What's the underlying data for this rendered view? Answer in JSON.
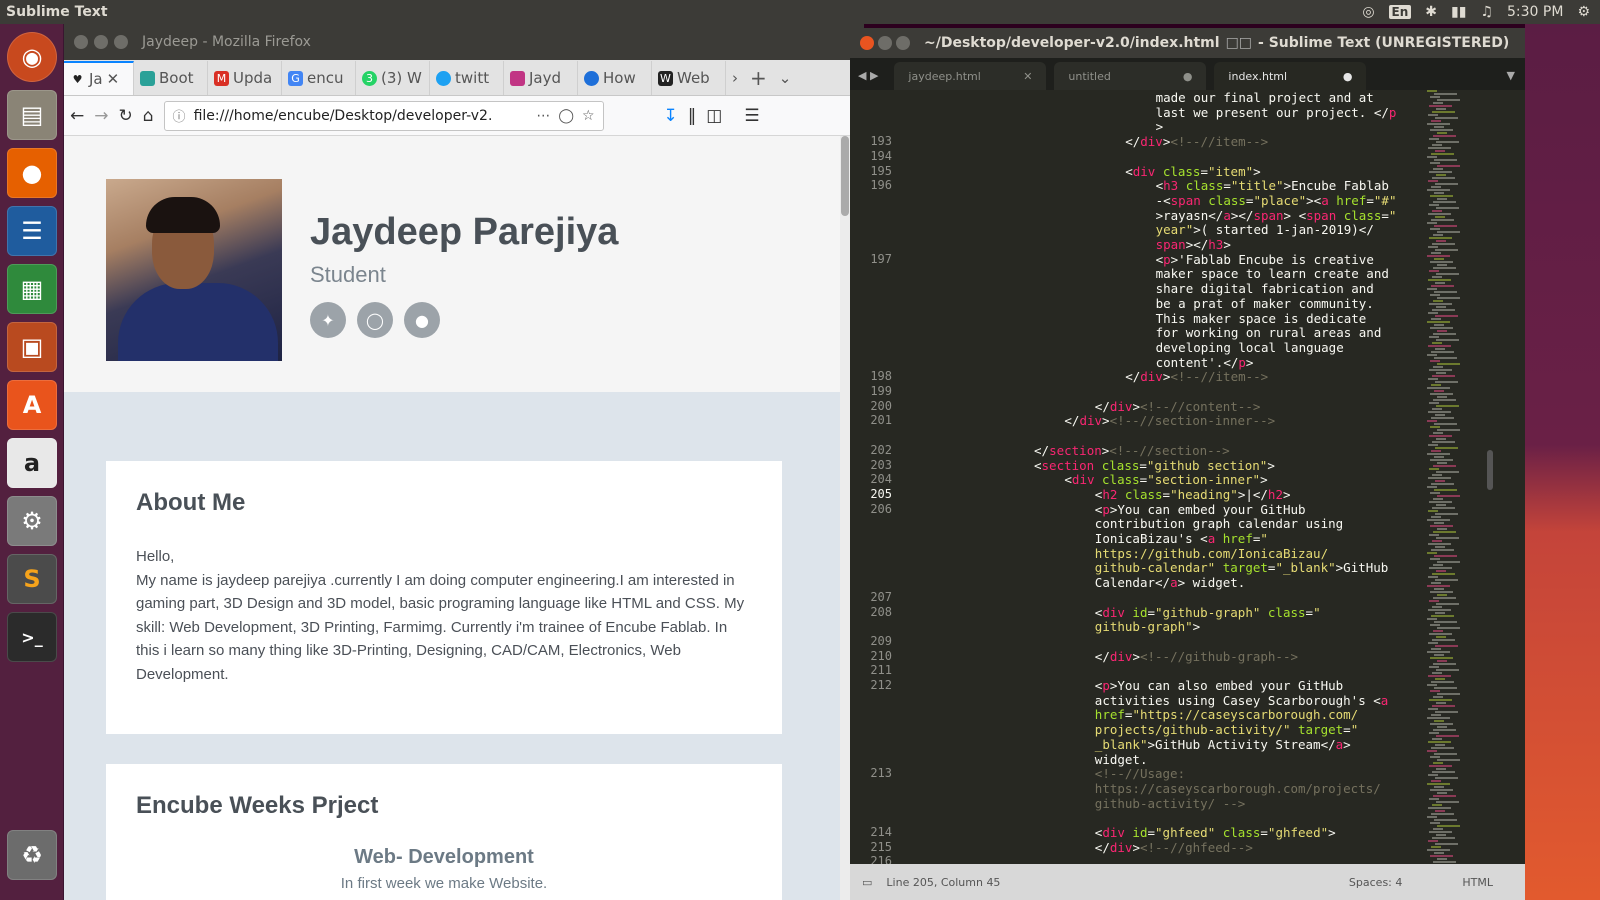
{
  "top_panel": {
    "app_name": "Sublime Text",
    "language": "En",
    "time": "5:30 PM"
  },
  "launcher": {
    "items": [
      "Ubuntu Dash",
      "Files",
      "Firefox",
      "LibreOffice Writer",
      "LibreOffice Calc",
      "LibreOffice Impress",
      "Ubuntu Software",
      "Amazon",
      "System Settings",
      "Sublime Text",
      "Terminal",
      "Trash"
    ]
  },
  "firefox": {
    "title": "Jaydeep - Mozilla Firefox",
    "tabs": [
      "Ja",
      "Boot",
      "Upda",
      "encu",
      "(3) W",
      "twitt",
      "Jayd",
      "How",
      "Web"
    ],
    "url": "file:///home/encube/Desktop/developer-v2."
  },
  "page": {
    "name": "Jaydeep Parejiya",
    "role": "Student",
    "about_title": "About Me",
    "about_text_1": "Hello,",
    "about_text_2": "My name is jaydeep parejiya .currently I am doing computer engineering.I am interested in gaming part, 3D Design and 3D model, basic programing language like HTML and CSS. My skill: Web Development, 3D Printing, Farmimg. Currently i'm trainee of Encube Fablab. In this i learn so many thing like 3D-Printing, Designing, CAD/CAM, Electronics, Web Development.",
    "weeks_title": "Encube Weeks Prject",
    "week1_title": "Web- Development",
    "week1_text": "In first week we make Website."
  },
  "sublime": {
    "title": "~/Desktop/developer-v2.0/index.html",
    "title_suffix": "- Sublime Text (UNREGISTERED)",
    "tabs": [
      "jaydeep.html",
      "untitled",
      "index.html"
    ],
    "status_position": "Line 205, Column 45",
    "status_spaces": "Spaces: 4",
    "status_syntax": "HTML"
  },
  "gutter_numbers": [
    {
      "n": "193",
      "r": 3
    },
    {
      "n": "194",
      "r": 4
    },
    {
      "n": "195",
      "r": 5
    },
    {
      "n": "196",
      "r": 6
    },
    {
      "n": "197",
      "r": 11
    },
    {
      "n": "198",
      "r": 19
    },
    {
      "n": "199",
      "r": 20
    },
    {
      "n": "200",
      "r": 21
    },
    {
      "n": "201",
      "r": 22
    },
    {
      "n": "202",
      "r": 24
    },
    {
      "n": "203",
      "r": 25
    },
    {
      "n": "204",
      "r": 26
    },
    {
      "n": "205",
      "r": 27
    },
    {
      "n": "206",
      "r": 28
    },
    {
      "n": "207",
      "r": 34
    },
    {
      "n": "208",
      "r": 35
    },
    {
      "n": "209",
      "r": 37
    },
    {
      "n": "210",
      "r": 38
    },
    {
      "n": "211",
      "r": 39
    },
    {
      "n": "212",
      "r": 40
    },
    {
      "n": "213",
      "r": 46
    },
    {
      "n": "214",
      "r": 50
    },
    {
      "n": "215",
      "r": 51
    },
    {
      "n": "216",
      "r": 52
    }
  ],
  "code_lines": [
    {
      "r": 0,
      "i": 16,
      "t": [
        [
          "",
          "made our final project and at"
        ]
      ]
    },
    {
      "r": 1,
      "i": 16,
      "t": [
        [
          "",
          "last we present our project. </"
        ],
        [
          "tg",
          "p"
        ]
      ]
    },
    {
      "r": 2,
      "i": 16,
      "t": [
        [
          "",
          ">"
        ]
      ]
    },
    {
      "r": 3,
      "i": 12,
      "t": [
        [
          "",
          "</"
        ],
        [
          "tg",
          "div"
        ],
        [
          "",
          ">"
        ],
        [
          "cm",
          "<!--//item-->"
        ]
      ]
    },
    {
      "r": 5,
      "i": 12,
      "t": [
        [
          "",
          "<"
        ],
        [
          "tg",
          "div"
        ],
        [
          "at",
          " class"
        ],
        [
          "",
          "="
        ],
        [
          "st",
          "\"item\""
        ],
        [
          "",
          ">"
        ]
      ]
    },
    {
      "r": 6,
      "i": 16,
      "t": [
        [
          "",
          "<"
        ],
        [
          "tg",
          "h3"
        ],
        [
          "at",
          " class"
        ],
        [
          "",
          "="
        ],
        [
          "st",
          "\"title\""
        ],
        [
          "",
          ">Encube Fablab"
        ]
      ]
    },
    {
      "r": 7,
      "i": 16,
      "t": [
        [
          "",
          "-<"
        ],
        [
          "tg",
          "span"
        ],
        [
          "at",
          " class"
        ],
        [
          "",
          "="
        ],
        [
          "st",
          "\"place\""
        ],
        [
          "",
          "><"
        ],
        [
          "tg",
          "a"
        ],
        [
          "at",
          " href"
        ],
        [
          "",
          "="
        ],
        [
          "st",
          "\"#\""
        ]
      ]
    },
    {
      "r": 8,
      "i": 16,
      "t": [
        [
          "",
          ">rayasn</"
        ],
        [
          "tg",
          "a"
        ],
        [
          "",
          "></"
        ],
        [
          "tg",
          "span"
        ],
        [
          "",
          "> <"
        ],
        [
          "tg",
          "span"
        ],
        [
          "at",
          " class"
        ],
        [
          "",
          "="
        ],
        [
          "st",
          "\""
        ]
      ]
    },
    {
      "r": 9,
      "i": 16,
      "t": [
        [
          "st",
          "year\""
        ],
        [
          "",
          ">( started 1-jan-2019)</"
        ]
      ]
    },
    {
      "r": 10,
      "i": 16,
      "t": [
        [
          "tg",
          "span"
        ],
        [
          "",
          "></"
        ],
        [
          "tg",
          "h3"
        ],
        [
          "",
          ">"
        ]
      ]
    },
    {
      "r": 11,
      "i": 16,
      "t": [
        [
          "",
          "<"
        ],
        [
          "tg",
          "p"
        ],
        [
          "",
          ">'Fablab Encube is creative"
        ]
      ]
    },
    {
      "r": 12,
      "i": 16,
      "t": [
        [
          "",
          "maker space to learn create and"
        ]
      ]
    },
    {
      "r": 13,
      "i": 16,
      "t": [
        [
          "",
          "share digital fabrication and"
        ]
      ]
    },
    {
      "r": 14,
      "i": 16,
      "t": [
        [
          "",
          "be a prat of maker community."
        ]
      ]
    },
    {
      "r": 15,
      "i": 16,
      "t": [
        [
          "",
          "This maker space is dedicate"
        ]
      ]
    },
    {
      "r": 16,
      "i": 16,
      "t": [
        [
          "",
          "for working on rural areas and"
        ]
      ]
    },
    {
      "r": 17,
      "i": 16,
      "t": [
        [
          "",
          "developing local language"
        ]
      ]
    },
    {
      "r": 18,
      "i": 16,
      "t": [
        [
          "",
          "content'.</"
        ],
        [
          "tg",
          "p"
        ],
        [
          "",
          ">"
        ]
      ]
    },
    {
      "r": 19,
      "i": 12,
      "t": [
        [
          "",
          "</"
        ],
        [
          "tg",
          "div"
        ],
        [
          "",
          ">"
        ],
        [
          "cm",
          "<!--//item-->"
        ]
      ]
    },
    {
      "r": 21,
      "i": 8,
      "t": [
        [
          "",
          "</"
        ],
        [
          "tg",
          "div"
        ],
        [
          "",
          ">"
        ],
        [
          "cm",
          "<!--//content-->"
        ]
      ]
    },
    {
      "r": 22,
      "i": 4,
      "t": [
        [
          "",
          "</"
        ],
        [
          "tg",
          "div"
        ],
        [
          "",
          ">"
        ],
        [
          "cm",
          "<!--//section-inner-->"
        ]
      ]
    },
    {
      "r": 24,
      "i": 0,
      "t": [
        [
          "",
          "</"
        ],
        [
          "tg",
          "section"
        ],
        [
          "",
          ">"
        ],
        [
          "cm",
          "<!--//section-->"
        ]
      ]
    },
    {
      "r": 25,
      "i": 0,
      "t": [
        [
          "",
          "<"
        ],
        [
          "tg",
          "section"
        ],
        [
          "at",
          " class"
        ],
        [
          "",
          "="
        ],
        [
          "st",
          "\"github section\""
        ],
        [
          "",
          ">"
        ]
      ]
    },
    {
      "r": 26,
      "i": 4,
      "t": [
        [
          "",
          "<"
        ],
        [
          "tg",
          "div"
        ],
        [
          "at",
          " class"
        ],
        [
          "",
          "="
        ],
        [
          "st",
          "\"section-inner\""
        ],
        [
          "",
          ">"
        ]
      ]
    },
    {
      "r": 27,
      "i": 8,
      "t": [
        [
          "",
          "<"
        ],
        [
          "tg",
          "h2"
        ],
        [
          "at",
          " class"
        ],
        [
          "",
          "="
        ],
        [
          "st",
          "\"heading\""
        ],
        [
          "",
          ">|</"
        ],
        [
          "tg",
          "h2"
        ],
        [
          "",
          ">"
        ]
      ]
    },
    {
      "r": 28,
      "i": 8,
      "t": [
        [
          "",
          "<"
        ],
        [
          "tg",
          "p"
        ],
        [
          "",
          ">You can embed your GitHub"
        ]
      ]
    },
    {
      "r": 29,
      "i": 8,
      "t": [
        [
          "",
          "contribution graph calendar using"
        ]
      ]
    },
    {
      "r": 30,
      "i": 8,
      "t": [
        [
          "",
          "IonicaBizau's <"
        ],
        [
          "tg",
          "a"
        ],
        [
          "at",
          " href"
        ],
        [
          "",
          "="
        ],
        [
          "st",
          "\""
        ]
      ]
    },
    {
      "r": 31,
      "i": 8,
      "t": [
        [
          "st",
          "https://github.com/IonicaBizau/"
        ]
      ]
    },
    {
      "r": 32,
      "i": 8,
      "t": [
        [
          "st",
          "github-calendar\""
        ],
        [
          "at",
          " target"
        ],
        [
          "",
          "="
        ],
        [
          "st",
          "\"_blank\""
        ],
        [
          "",
          ">GitHub"
        ]
      ]
    },
    {
      "r": 33,
      "i": 8,
      "t": [
        [
          "",
          "Calendar</"
        ],
        [
          "tg",
          "a"
        ],
        [
          "",
          "> widget."
        ]
      ]
    },
    {
      "r": 35,
      "i": 8,
      "t": [
        [
          "",
          "<"
        ],
        [
          "tg",
          "div"
        ],
        [
          "at",
          " id"
        ],
        [
          "",
          "="
        ],
        [
          "st",
          "\"github-graph\""
        ],
        [
          "at",
          " class"
        ],
        [
          "",
          "="
        ],
        [
          "st",
          "\""
        ]
      ]
    },
    {
      "r": 36,
      "i": 8,
      "t": [
        [
          "st",
          "github-graph\""
        ],
        [
          "",
          ">"
        ]
      ]
    },
    {
      "r": 38,
      "i": 8,
      "t": [
        [
          "",
          "</"
        ],
        [
          "tg",
          "div"
        ],
        [
          "",
          ">"
        ],
        [
          "cm",
          "<!--//github-graph-->"
        ]
      ]
    },
    {
      "r": 40,
      "i": 8,
      "t": [
        [
          "",
          "<"
        ],
        [
          "tg",
          "p"
        ],
        [
          "",
          ">You can also embed your GitHub"
        ]
      ]
    },
    {
      "r": 41,
      "i": 8,
      "t": [
        [
          "",
          "activities using Casey Scarborough's <"
        ],
        [
          "tg",
          "a"
        ]
      ]
    },
    {
      "r": 42,
      "i": 8,
      "t": [
        [
          "at",
          "href"
        ],
        [
          "",
          "="
        ],
        [
          "st",
          "\"https://caseyscarborough.com/"
        ]
      ]
    },
    {
      "r": 43,
      "i": 8,
      "t": [
        [
          "st",
          "projects/github-activity/\""
        ],
        [
          "at",
          " target"
        ],
        [
          "",
          "="
        ],
        [
          "st",
          "\""
        ]
      ]
    },
    {
      "r": 44,
      "i": 8,
      "t": [
        [
          "st",
          "_blank\""
        ],
        [
          "",
          ">GitHub Activity Stream</"
        ],
        [
          "tg",
          "a"
        ],
        [
          "",
          ">"
        ]
      ]
    },
    {
      "r": 45,
      "i": 8,
      "t": [
        [
          "",
          "widget."
        ]
      ]
    },
    {
      "r": 46,
      "i": 8,
      "t": [
        [
          "cm",
          "<!--//Usage:"
        ]
      ]
    },
    {
      "r": 47,
      "i": 8,
      "t": [
        [
          "cm",
          "https://caseyscarborough.com/projects/"
        ]
      ]
    },
    {
      "r": 48,
      "i": 8,
      "t": [
        [
          "cm",
          "github-activity/ -->"
        ]
      ]
    },
    {
      "r": 50,
      "i": 8,
      "t": [
        [
          "",
          "<"
        ],
        [
          "tg",
          "div"
        ],
        [
          "at",
          " id"
        ],
        [
          "",
          "="
        ],
        [
          "st",
          "\"ghfeed\""
        ],
        [
          "at",
          " class"
        ],
        [
          "",
          "="
        ],
        [
          "st",
          "\"ghfeed\""
        ],
        [
          "",
          ">"
        ]
      ]
    },
    {
      "r": 51,
      "i": 8,
      "t": [
        [
          "",
          "</"
        ],
        [
          "tg",
          "div"
        ],
        [
          "",
          ">"
        ],
        [
          "cm",
          "<!--//ghfeed-->"
        ]
      ]
    }
  ]
}
